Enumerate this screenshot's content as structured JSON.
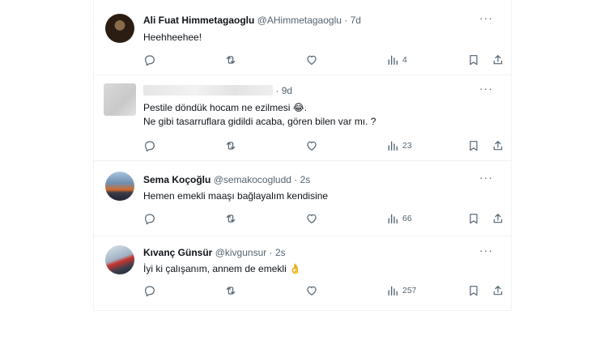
{
  "tweets": [
    {
      "name": "Ali Fuat Himmetagaoglu",
      "handle": "@AHimmetagaoglu",
      "sep": "·",
      "time": "7d",
      "lines": [
        "Heehheehee!"
      ],
      "views": "4"
    },
    {
      "name": "",
      "handle": "",
      "sep": "·",
      "time": "9d",
      "lines": [
        "Pestile döndük hocam ne ezilmesi 😂.",
        "Ne gibi tasarruflara gidildi acaba, gören bilen var mı. ?"
      ],
      "views": "23"
    },
    {
      "name": "Sema Koçoğlu",
      "handle": "@semakocogludd",
      "sep": "·",
      "time": "2s",
      "lines": [
        "Hemen emekli maaşı bağlayalım kendisine"
      ],
      "views": "66"
    },
    {
      "name": "Kıvanç Günsür",
      "handle": "@kivgunsur",
      "sep": "·",
      "time": "2s",
      "lines": [
        "İyi ki çalışanım, annem de emekli 👌"
      ],
      "views": "257"
    }
  ],
  "icons": {
    "more": "more-icon",
    "reply": "reply-icon",
    "retweet": "retweet-icon",
    "like": "heart-icon",
    "views": "views-icon",
    "bookmark": "bookmark-icon",
    "share": "share-icon"
  },
  "colors": {
    "text": "#0f1419",
    "muted": "#536471",
    "border": "#eff3f4"
  }
}
